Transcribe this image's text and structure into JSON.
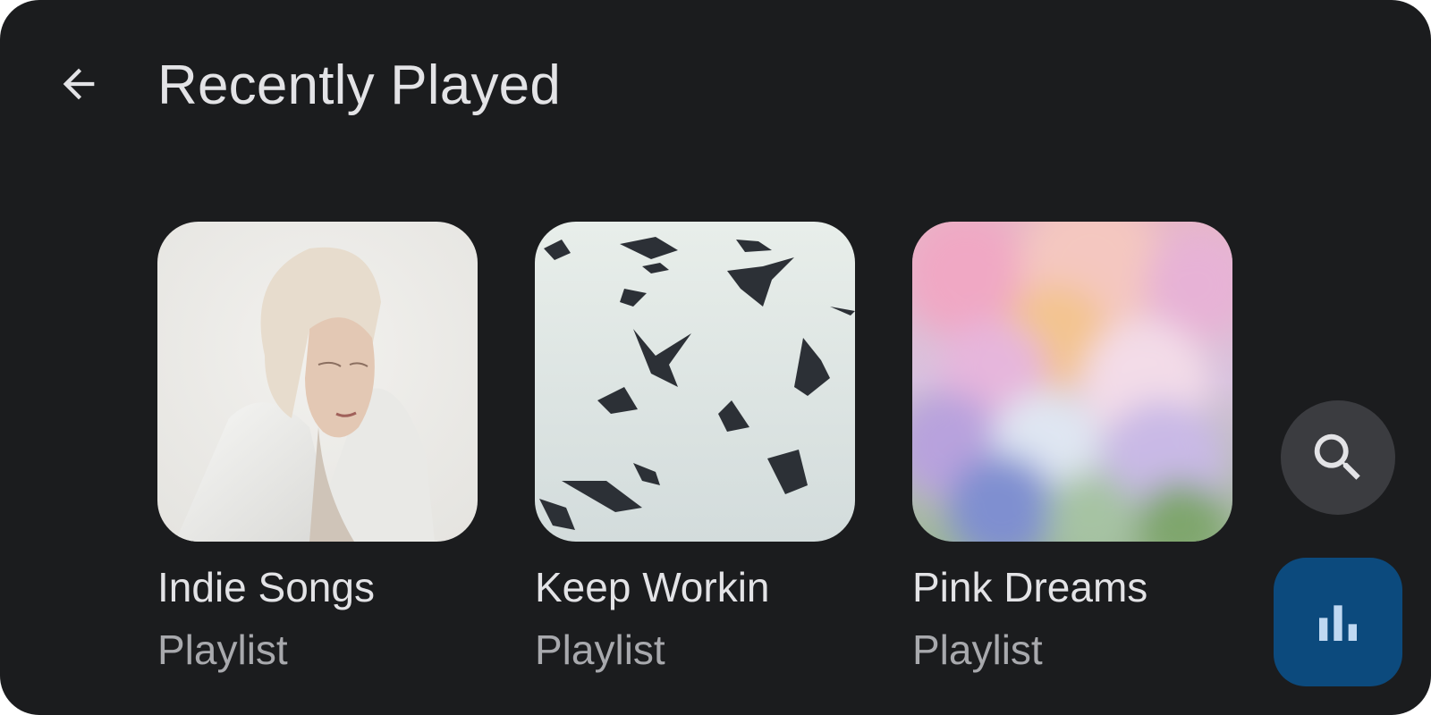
{
  "header": {
    "back_icon": "arrow-back-icon",
    "title": "Recently Played"
  },
  "playlists": [
    {
      "title": "Indie Songs",
      "subtitle": "Playlist",
      "art": "woman-in-white-wrap"
    },
    {
      "title": "Keep Workin",
      "subtitle": "Playlist",
      "art": "flying-pigeons"
    },
    {
      "title": "Pink Dreams",
      "subtitle": "Playlist",
      "art": "blurred-flowers"
    }
  ],
  "actions": {
    "search_icon": "search-icon",
    "now_playing_icon": "equalizer-bars-icon"
  },
  "colors": {
    "background": "#1b1c1e",
    "text_primary": "#e3e3e6",
    "text_secondary": "#a8a9ad",
    "search_fab": "#3b3c40",
    "now_playing_fab": "#0c4a7d",
    "now_playing_icon": "#bfd8f2"
  }
}
